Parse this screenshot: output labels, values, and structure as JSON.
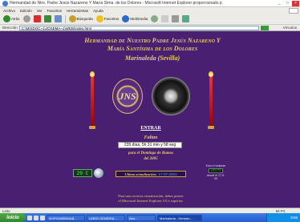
{
  "window": {
    "title": "Hermandad de Ntro. Padre Jesús Nazareno Y María Stma. de los Dolores - Microsoft Internet Explorer proporcionado p",
    "buttons": [
      "_",
      "□",
      "×"
    ]
  },
  "menu": [
    "Archivo",
    "Edición",
    "Ver",
    "Favoritos",
    "Herramientas",
    "Ayuda"
  ],
  "toolbar": {
    "back": "Atrás",
    "search": "Búsqueda",
    "favorites": "Favoritos",
    "multimedia": "Multimedia"
  },
  "address": {
    "label": "Dirección",
    "value": "C:\\MISDOC~1\\JOSEMA~1\\WEB\\Index.html",
    "links": "Vínculos"
  },
  "page": {
    "heading_line1": "Hermandad de Nuestro Padre Jesús Nazareno Y",
    "heading_line2": "María Santísima de los Dolores",
    "place": "Marinaleda  (Sevilla)",
    "emblem_text": "JNS",
    "entrar": "ENTRAR",
    "faltan": "Faltan",
    "counter": "235 días, 5h 31 min y 58 seg",
    "ramos_line1": "para el Domingo de Ramos",
    "ramos_line2": "del 2005",
    "temperature": "29 C",
    "update_label": "Ultima actualización:",
    "update_value": "17-07-2004",
    "visits_label": "Eres el visitante",
    "visits_value": "23172",
    "visits_since": "desde el 27-9-99",
    "note_line1": "Para una correcta visualización, debes poseer",
    "note_line2": "el Microsoft Internet Explorer 5.0 ó superior."
  },
  "status": {
    "left": "Listo",
    "zone": "Mi PC"
  },
  "taskbar": {
    "start": "Inicio",
    "tasks": [
      "W:\\PG\\WEB\\HAB...",
      "LIBRO GENERAL...",
      "Aire...",
      "Marinaleda - Herman..."
    ],
    "clock": "9:55"
  },
  "colors": {
    "page_bg": "#481f71",
    "gold_text": "#e8cf6a"
  }
}
